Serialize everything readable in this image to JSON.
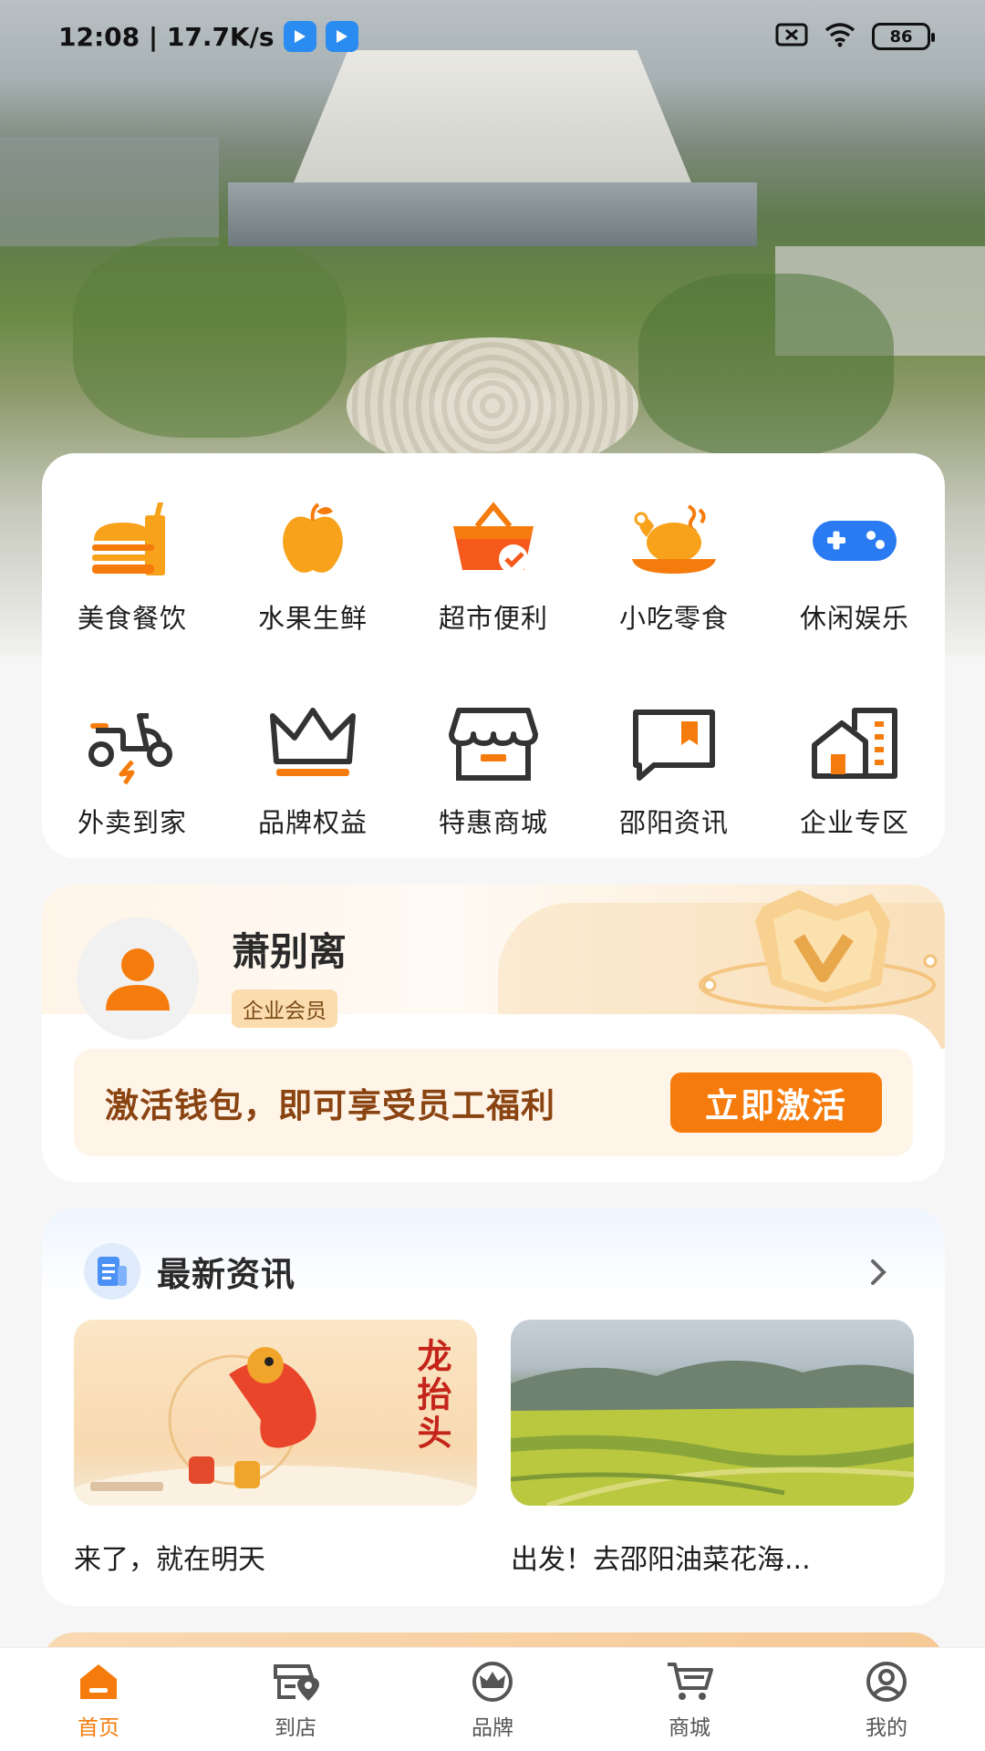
{
  "status_bar": {
    "time_speed": "12:08 | 17.7K/s",
    "battery": "86"
  },
  "categories": [
    {
      "label": "美食餐饮",
      "icon": "burger-drink-icon"
    },
    {
      "label": "水果生鲜",
      "icon": "apple-icon"
    },
    {
      "label": "超市便利",
      "icon": "shopping-basket-icon"
    },
    {
      "label": "小吃零食",
      "icon": "roast-chicken-icon"
    },
    {
      "label": "休闲娱乐",
      "icon": "gamepad-icon"
    },
    {
      "label": "外卖到家",
      "icon": "delivery-scooter-icon"
    },
    {
      "label": "品牌权益",
      "icon": "crown-icon"
    },
    {
      "label": "特惠商城",
      "icon": "storefront-icon"
    },
    {
      "label": "邵阳资讯",
      "icon": "news-chat-icon"
    },
    {
      "label": "企业专区",
      "icon": "enterprise-building-icon"
    }
  ],
  "member": {
    "name": "萧别离",
    "badge": "企业会员",
    "activate_text": "激活钱包，即可享受员工福利",
    "activate_button": "立即激活"
  },
  "news": {
    "title": "最新资讯",
    "items": [
      {
        "caption": "来了，就在明天",
        "image": "dragon-festival-image",
        "image_text": "龙抬头"
      },
      {
        "caption": "出发！去邵阳油菜花海...",
        "image": "rapeseed-field-image"
      }
    ]
  },
  "tabbar": [
    {
      "label": "首页",
      "icon": "home-icon",
      "active": true
    },
    {
      "label": "到店",
      "icon": "store-location-icon",
      "active": false
    },
    {
      "label": "品牌",
      "icon": "brand-crown-icon",
      "active": false
    },
    {
      "label": "商城",
      "icon": "cart-icon",
      "active": false
    },
    {
      "label": "我的",
      "icon": "profile-icon",
      "active": false
    }
  ],
  "colors": {
    "accent": "#f57c0c",
    "icon_dark": "#333333"
  }
}
